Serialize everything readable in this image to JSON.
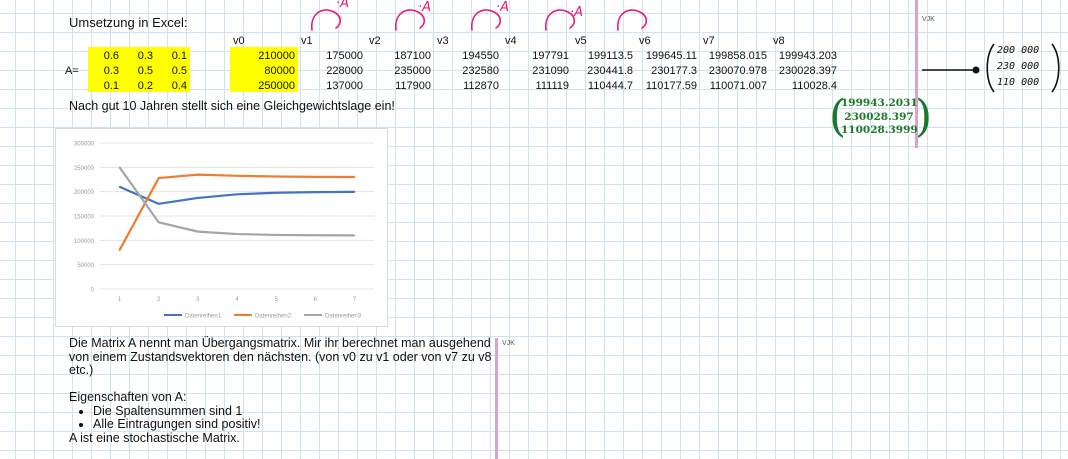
{
  "heading": "Umsetzung in Excel:",
  "annotations": {
    "vjk_top": "VJK",
    "vjk_bottom": "VJK",
    "step_label": "·A"
  },
  "table": {
    "matrix_label": "A=",
    "headers": [
      "v0",
      "v1",
      "v2",
      "v3",
      "v4",
      "v5",
      "v6",
      "v7",
      "v8"
    ],
    "matrix": [
      [
        "0.6",
        "0.3",
        "0.1"
      ],
      [
        "0.3",
        "0.5",
        "0.5"
      ],
      [
        "0.1",
        "0.2",
        "0.4"
      ]
    ],
    "vectors": [
      [
        "210000",
        "175000",
        "187100",
        "194550",
        "197791",
        "199113.5",
        "199645.11",
        "199858.015",
        "199943.203"
      ],
      [
        "80000",
        "228000",
        "235000",
        "232580",
        "231090",
        "230441.8",
        "230177.3",
        "230070.978",
        "230028.397"
      ],
      [
        "250000",
        "137000",
        "117900",
        "112870",
        "111119",
        "110444.7",
        "110177.59",
        "110071.007",
        "110028.4"
      ]
    ]
  },
  "note": "Nach gut 10 Jahren stellt sich eine Gleichgewichtslage ein!",
  "result_vector": [
    "199943.2031",
    "230028.397",
    "110028.3999"
  ],
  "handwritten_vector": [
    "200 000",
    "230 000",
    "110 000"
  ],
  "chart_data": {
    "type": "line",
    "x": [
      1,
      2,
      3,
      4,
      5,
      6,
      7
    ],
    "ylim": [
      0,
      300000
    ],
    "yticks": [
      "300000",
      "250000",
      "200000",
      "150000",
      "100000",
      "50000",
      "0"
    ],
    "series": [
      {
        "name": "Datenreihen1",
        "color": "#4472c4",
        "values": [
          210000,
          175000,
          187100,
          194550,
          197791,
          199113.5,
          199645.11
        ]
      },
      {
        "name": "Datenreihen2",
        "color": "#ed7d31",
        "values": [
          80000,
          228000,
          235000,
          232580,
          231090,
          230441.8,
          230177.3
        ]
      },
      {
        "name": "Datenreihen3",
        "color": "#a5a5a5",
        "values": [
          250000,
          137000,
          117900,
          112870,
          111119,
          110444.7,
          110177.59
        ]
      }
    ],
    "legend": "bottom",
    "grid": true
  },
  "body": {
    "paragraph": "Die Matrix A nennt man Übergangsmatrix. Mir ihr berechnet man ausgehend von einem Zustandsvektoren den nächsten. (von v0 zu v1 oder von v7 zu v8 etc.)",
    "properties_title": "Eigenschaften von A:",
    "properties": [
      "Die Spaltensummen sind 1",
      "Alle Eintragungen sind positiv!"
    ],
    "conclusion": "A ist eine stochastische Matrix."
  }
}
